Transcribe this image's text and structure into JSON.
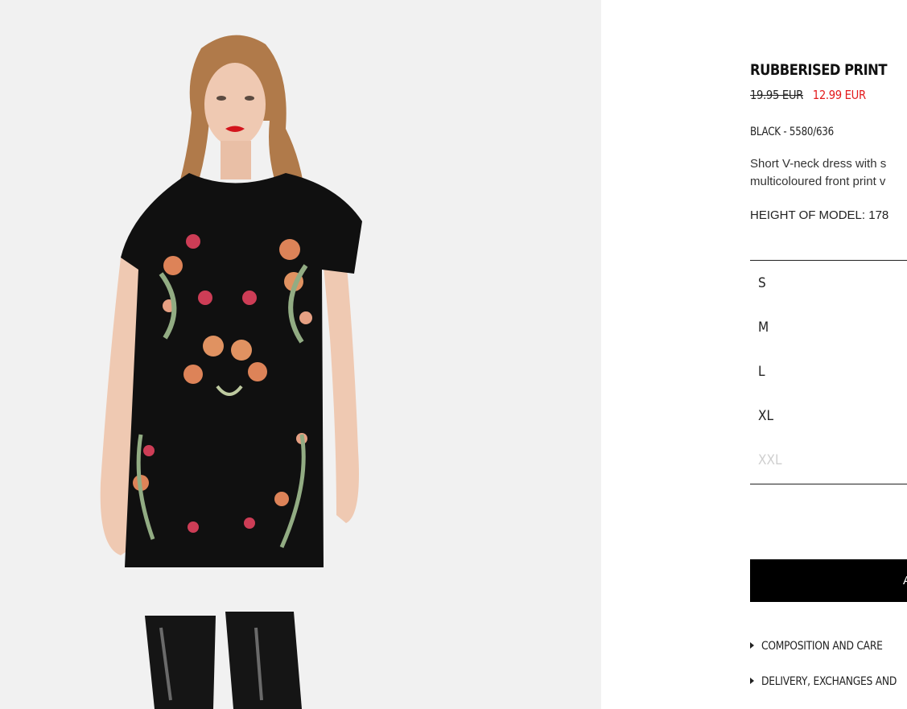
{
  "product": {
    "title": "RUBBERISED PRINT",
    "old_price": "19.95 EUR",
    "sale_price": "12.99 EUR",
    "color_ref": "BLACK - 5580/636",
    "description_lines": [
      "Short V-neck dress with s",
      "multicoloured front print v"
    ],
    "model_height": "HEIGHT OF MODEL: 178"
  },
  "sizes": [
    {
      "label": "S",
      "available": true
    },
    {
      "label": "M",
      "available": true
    },
    {
      "label": "L",
      "available": true
    },
    {
      "label": "XL",
      "available": true
    },
    {
      "label": "XXL",
      "available": false
    }
  ],
  "add_button": {
    "label": "A"
  },
  "accordions": [
    "COMPOSITION AND CARE",
    "DELIVERY, EXCHANGES AND"
  ],
  "colors": {
    "sale_price": "#e31a1c",
    "button_bg": "#000000",
    "disabled_size": "#cfcfcf",
    "image_bg": "#f1f1f1"
  }
}
